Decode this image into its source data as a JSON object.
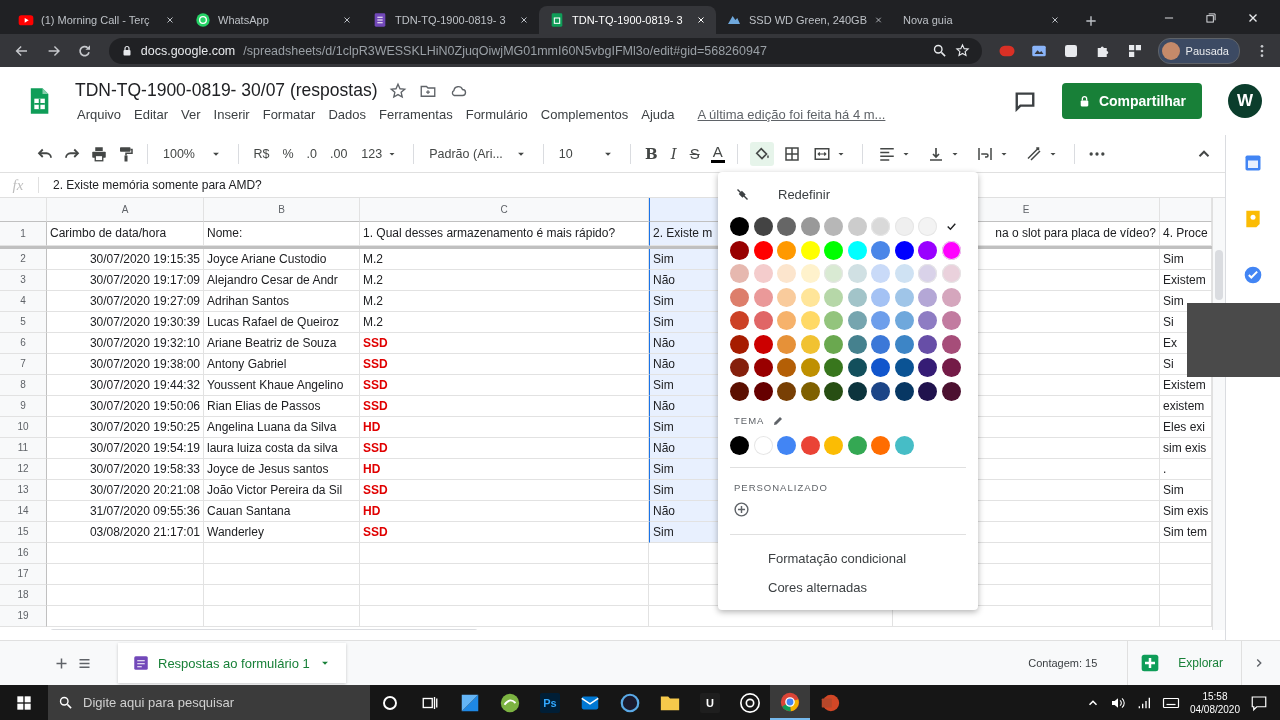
{
  "browser": {
    "tabs": [
      {
        "kind": "video",
        "title": "(1) Morning Call - Terç",
        "selected": false
      },
      {
        "kind": "chat",
        "title": "WhatsApp",
        "selected": false
      },
      {
        "kind": "form",
        "title": "TDN-TQ-1900-0819- 3",
        "selected": false
      },
      {
        "kind": "sheet",
        "title": "TDN-TQ-1900-0819- 3",
        "selected": true
      },
      {
        "kind": "store",
        "title": "SSD WD Green, 240GB",
        "selected": false
      },
      {
        "kind": "blank",
        "title": "Nova guia",
        "selected": false
      }
    ],
    "url_host": "docs.google.com",
    "url_path": "/spreadsheets/d/1clpR3WESSKLHiN0ZjuqOiwjMG01mmI60N5vbgIFMl3o/edit#gid=568260947",
    "profile": "Pausada"
  },
  "doc": {
    "title": "TDN-TQ-1900-0819- 30/07 (respostas)",
    "menu": [
      "Arquivo",
      "Editar",
      "Ver",
      "Inserir",
      "Formatar",
      "Dados",
      "Ferramentas",
      "Formulário",
      "Complementos",
      "Ajuda"
    ],
    "last_edit": "A última edição foi feita há 4 m...",
    "share": "Compartilhar",
    "avatar": "W"
  },
  "toolbar": {
    "zoom": "100%",
    "currency": "R$",
    "percent": "%",
    "decimal_less": ".0",
    "decimal_more": ".00",
    "number_format": "123",
    "font": "Padrão (Ari...",
    "font_size": "10",
    "bold": "B",
    "italic": "I",
    "strike": "S",
    "text_color": "A"
  },
  "formula_bar": {
    "label": "fx",
    "content": "2. Existe memória somente para AMD?"
  },
  "grid": {
    "columns": [
      {
        "letter": "A",
        "selected": false
      },
      {
        "letter": "B",
        "selected": false
      },
      {
        "letter": "C",
        "selected": false
      },
      {
        "selected": true
      },
      {
        "letter": "E",
        "selected": false
      },
      {
        "selected": false
      }
    ],
    "header_row": {
      "number": "1",
      "cells": [
        "Carimbo de data/hora",
        "Nome:",
        "1. Qual desses armazenamento é mais rápido?",
        "2. Existe m",
        "na o slot para placa de vídeo?",
        "4. Proce"
      ]
    },
    "rows": [
      {
        "number": "2",
        "timestamp": "30/07/2020 19:15:35",
        "name": "Joyce Ariane Custodio",
        "q1": {
          "text": "M.2",
          "kind": "plain"
        },
        "q2": "Sim",
        "q4": "Sim"
      },
      {
        "number": "3",
        "timestamp": "30/07/2020 19:17:09",
        "name": "Alejandro Cesar de Andr",
        "q1": {
          "text": "M.2",
          "kind": "plain"
        },
        "q2": "Não",
        "q4": "Existem"
      },
      {
        "number": "4",
        "timestamp": "30/07/2020 19:27:09",
        "name": "Adrihan Santos",
        "q1": {
          "text": "M.2",
          "kind": "plain"
        },
        "q2": "Sim",
        "q4": "Sim"
      },
      {
        "number": "5",
        "timestamp": "30/07/2020 19:30:39",
        "name": "Lucas Rafael de Queiroz",
        "q1": {
          "text": "M.2",
          "kind": "plain"
        },
        "q2": "Sim",
        "q4": "Si"
      },
      {
        "number": "6",
        "timestamp": "30/07/2020 19:32:10",
        "name": "Ariane Beatriz de Souza",
        "q1": {
          "text": "SSD",
          "kind": "flagged"
        },
        "q2": "Não",
        "q4": "Ex"
      },
      {
        "number": "7",
        "timestamp": "30/07/2020 19:38:00",
        "name": "Antony Gabriel",
        "q1": {
          "text": "SSD",
          "kind": "flagged"
        },
        "q2": "Não",
        "q4": "Si"
      },
      {
        "number": "8",
        "timestamp": "30/07/2020 19:44:32",
        "name": "Youssent Khaue Angelino",
        "q1": {
          "text": "SSD",
          "kind": "flagged"
        },
        "q2": "Sim",
        "q4": "Existem"
      },
      {
        "number": "9",
        "timestamp": "30/07/2020 19:50:06",
        "name": "Rian Elias de Passos",
        "q1": {
          "text": "SSD",
          "kind": "flagged"
        },
        "q2": "Não",
        "q4": "existem"
      },
      {
        "number": "10",
        "timestamp": "30/07/2020 19:50:25",
        "name": "Angelina Luana da Silva",
        "q1": {
          "text": "HD",
          "kind": "flagged"
        },
        "q2": "Sim",
        "q4": "Eles exi"
      },
      {
        "number": "11",
        "timestamp": "30/07/2020 19:54:19",
        "name": "laura luiza costa da silva",
        "q1": {
          "text": "SSD",
          "kind": "flagged"
        },
        "q2": "Não",
        "q4": "sim exis"
      },
      {
        "number": "12",
        "timestamp": "30/07/2020 19:58:33",
        "name": "Joyce de Jesus santos",
        "q1": {
          "text": "HD",
          "kind": "flagged"
        },
        "q2": "Sim",
        "q4": "."
      },
      {
        "number": "13",
        "timestamp": "30/07/2020 20:21:08",
        "name": "João Victor Pereira da Sil",
        "q1": {
          "text": "SSD",
          "kind": "flagged"
        },
        "q2": "Sim",
        "q4": "Sim"
      },
      {
        "number": "14",
        "timestamp": "31/07/2020 09:55:36",
        "name": "Cauan Santana",
        "q1": {
          "text": "HD",
          "kind": "flagged"
        },
        "q2": "Não",
        "q4": "Sim exis"
      },
      {
        "number": "15",
        "timestamp": "03/08/2020 21:17:01",
        "name": "Wanderley",
        "q1": {
          "text": "SSD",
          "kind": "flagged"
        },
        "q2": "Sim",
        "q4": "Sim tem"
      }
    ],
    "empty_rows": [
      "16",
      "17",
      "18",
      "19"
    ]
  },
  "color_menu": {
    "open": true,
    "reset": "Redefinir",
    "swatches": [
      [
        {
          "color": "#000000",
          "selected": false
        },
        {
          "color": "#434343",
          "selected": false
        },
        {
          "color": "#666666",
          "selected": false
        },
        {
          "color": "#999999",
          "selected": false
        },
        {
          "color": "#b7b7b7",
          "selected": false
        },
        {
          "color": "#cccccc",
          "selected": false
        },
        {
          "color": "#d9d9d9",
          "selected": false
        },
        {
          "color": "#efefef",
          "selected": false
        },
        {
          "color": "#f3f3f3",
          "selected": false
        },
        {
          "color": "#ffffff",
          "selected": true
        }
      ],
      [
        {
          "color": "#980000",
          "selected": false
        },
        {
          "color": "#ff0000",
          "selected": false
        },
        {
          "color": "#ff9900",
          "selected": false
        },
        {
          "color": "#ffff00",
          "selected": false
        },
        {
          "color": "#00ff00",
          "selected": false
        },
        {
          "color": "#00ffff",
          "selected": false
        },
        {
          "color": "#4a86e8",
          "selected": false
        },
        {
          "color": "#0000ff",
          "selected": false
        },
        {
          "color": "#9900ff",
          "selected": false
        },
        {
          "color": "#ff00ff",
          "selected": false
        }
      ],
      [
        {
          "color": "#e6b8af",
          "selected": false
        },
        {
          "color": "#f4cccc",
          "selected": false
        },
        {
          "color": "#fce5cd",
          "selected": false
        },
        {
          "color": "#fff2cc",
          "selected": false
        },
        {
          "color": "#d9ead3",
          "selected": false
        },
        {
          "color": "#d0e0e3",
          "selected": false
        },
        {
          "color": "#c9daf8",
          "selected": false
        },
        {
          "color": "#cfe2f3",
          "selected": false
        },
        {
          "color": "#d9d2e9",
          "selected": false
        },
        {
          "color": "#ead1dc",
          "selected": false
        }
      ],
      [
        {
          "color": "#dd7e6b",
          "selected": false
        },
        {
          "color": "#ea9999",
          "selected": false
        },
        {
          "color": "#f9cb9c",
          "selected": false
        },
        {
          "color": "#ffe599",
          "selected": false
        },
        {
          "color": "#b6d7a8",
          "selected": false
        },
        {
          "color": "#a2c4c9",
          "selected": false
        },
        {
          "color": "#a4c2f4",
          "selected": false
        },
        {
          "color": "#9fc5e8",
          "selected": false
        },
        {
          "color": "#b4a7d6",
          "selected": false
        },
        {
          "color": "#d5a6bd",
          "selected": false
        }
      ],
      [
        {
          "color": "#cc4125",
          "selected": false
        },
        {
          "color": "#e06666",
          "selected": false
        },
        {
          "color": "#f6b26b",
          "selected": false
        },
        {
          "color": "#ffd966",
          "selected": false
        },
        {
          "color": "#93c47d",
          "selected": false
        },
        {
          "color": "#76a5af",
          "selected": false
        },
        {
          "color": "#6d9eeb",
          "selected": false
        },
        {
          "color": "#6fa8dc",
          "selected": false
        },
        {
          "color": "#8e7cc3",
          "selected": false
        },
        {
          "color": "#c27ba0",
          "selected": false
        }
      ],
      [
        {
          "color": "#a61c00",
          "selected": false
        },
        {
          "color": "#cc0000",
          "selected": false
        },
        {
          "color": "#e69138",
          "selected": false
        },
        {
          "color": "#f1c232",
          "selected": false
        },
        {
          "color": "#6aa84f",
          "selected": false
        },
        {
          "color": "#45818e",
          "selected": false
        },
        {
          "color": "#3c78d8",
          "selected": false
        },
        {
          "color": "#3d85c6",
          "selected": false
        },
        {
          "color": "#674ea7",
          "selected": false
        },
        {
          "color": "#a64d79",
          "selected": false
        }
      ],
      [
        {
          "color": "#85200c",
          "selected": false
        },
        {
          "color": "#990000",
          "selected": false
        },
        {
          "color": "#b45f06",
          "selected": false
        },
        {
          "color": "#bf9000",
          "selected": false
        },
        {
          "color": "#38761d",
          "selected": false
        },
        {
          "color": "#134f5c",
          "selected": false
        },
        {
          "color": "#1155cc",
          "selected": false
        },
        {
          "color": "#0b5394",
          "selected": false
        },
        {
          "color": "#351c75",
          "selected": false
        },
        {
          "color": "#741b47",
          "selected": false
        }
      ],
      [
        {
          "color": "#5b0f00",
          "selected": false
        },
        {
          "color": "#660000",
          "selected": false
        },
        {
          "color": "#783f04",
          "selected": false
        },
        {
          "color": "#7f6000",
          "selected": false
        },
        {
          "color": "#274e13",
          "selected": false
        },
        {
          "color": "#0c343d",
          "selected": false
        },
        {
          "color": "#1c4587",
          "selected": false
        },
        {
          "color": "#073763",
          "selected": false
        },
        {
          "color": "#20124d",
          "selected": false
        },
        {
          "color": "#4c1130",
          "selected": false
        }
      ]
    ],
    "theme_label": "TEMA",
    "theme": [
      {
        "color": "#000000",
        "selected": false
      },
      {
        "color": "#ffffff",
        "selected": false
      },
      {
        "color": "#4285f4",
        "selected": false
      },
      {
        "color": "#ea4335",
        "selected": false
      },
      {
        "color": "#fbbc04",
        "selected": false
      },
      {
        "color": "#34a853",
        "selected": false
      },
      {
        "color": "#ff6d01",
        "selected": false
      },
      {
        "color": "#46bdc6",
        "selected": false
      }
    ],
    "custom_label": "PERSONALIZADO",
    "items": [
      "Formatação condicional",
      "Cores alternadas"
    ]
  },
  "sheet_bar": {
    "tabs": [
      {
        "name": "Respostas ao formulário 1",
        "selected": true
      }
    ],
    "status": "Contagem: 15",
    "explore": "Explorar"
  },
  "taskbar": {
    "search_placeholder": "Digite aqui para pesquisar",
    "apps": [
      {
        "selected": false
      },
      {
        "selected": false
      },
      {
        "label": "Ps",
        "selected": false
      },
      {
        "selected": false
      },
      {
        "selected": false
      },
      {
        "selected": false
      },
      {
        "label": "U",
        "selected": false
      },
      {
        "selected": false
      },
      {
        "selected": true
      },
      {
        "selected": false
      }
    ],
    "time": "15:58",
    "date": "04/08/2020"
  }
}
